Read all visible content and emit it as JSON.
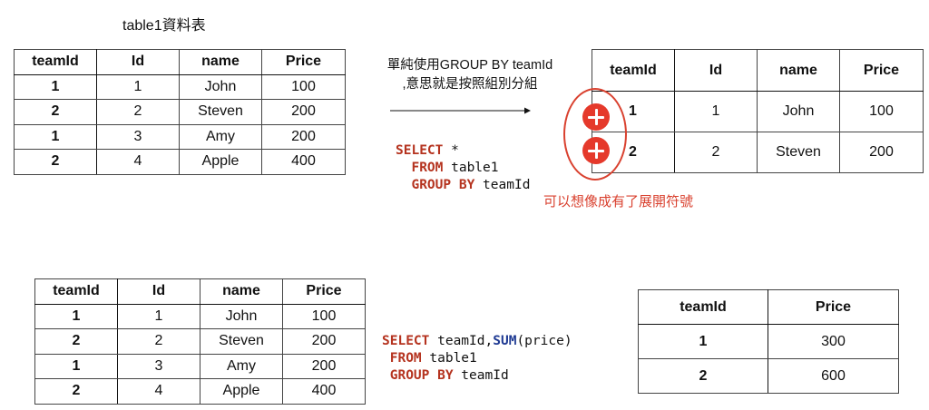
{
  "top_left": {
    "title": "table1資料表",
    "headers": [
      "teamId",
      "Id",
      "name",
      "Price"
    ],
    "rows": [
      [
        "1",
        "1",
        "John",
        "100"
      ],
      [
        "2",
        "2",
        "Steven",
        "200"
      ],
      [
        "1",
        "3",
        "Amy",
        "200"
      ],
      [
        "2",
        "4",
        "Apple",
        "400"
      ]
    ]
  },
  "top_middle": {
    "note_line1": "單純使用GROUP BY teamId",
    "note_line2": ",意思就是按照組別分組",
    "sql": {
      "kw_select": "SELECT",
      "select_rest": " *",
      "kw_from": "FROM",
      "from_rest": " table1",
      "kw_group": "GROUP BY",
      "group_rest": " teamId"
    }
  },
  "top_right": {
    "headers": [
      "teamId",
      "Id",
      "name",
      "Price"
    ],
    "rows": [
      [
        "1",
        "1",
        "John",
        "100"
      ],
      [
        "2",
        "2",
        "Steven",
        "200"
      ]
    ],
    "expand_note": "可以想像成有了展開符號",
    "accent_color": "#e5392b"
  },
  "bottom_left": {
    "headers": [
      "teamId",
      "Id",
      "name",
      "Price"
    ],
    "rows": [
      [
        "1",
        "1",
        "John",
        "100"
      ],
      [
        "2",
        "2",
        "Steven",
        "200"
      ],
      [
        "1",
        "3",
        "Amy",
        "200"
      ],
      [
        "2",
        "4",
        "Apple",
        "400"
      ]
    ]
  },
  "bottom_middle": {
    "sql": {
      "kw_select": "SELECT",
      "select_mid": " teamId,",
      "fn_sum": "SUM",
      "select_rest": "(price)",
      "kw_from": "FROM",
      "from_rest": " table1",
      "kw_group": "GROUP BY",
      "group_rest": " teamId"
    }
  },
  "bottom_right": {
    "headers": [
      "teamId",
      "Price"
    ],
    "rows": [
      [
        "1",
        "300"
      ],
      [
        "2",
        "600"
      ]
    ]
  }
}
